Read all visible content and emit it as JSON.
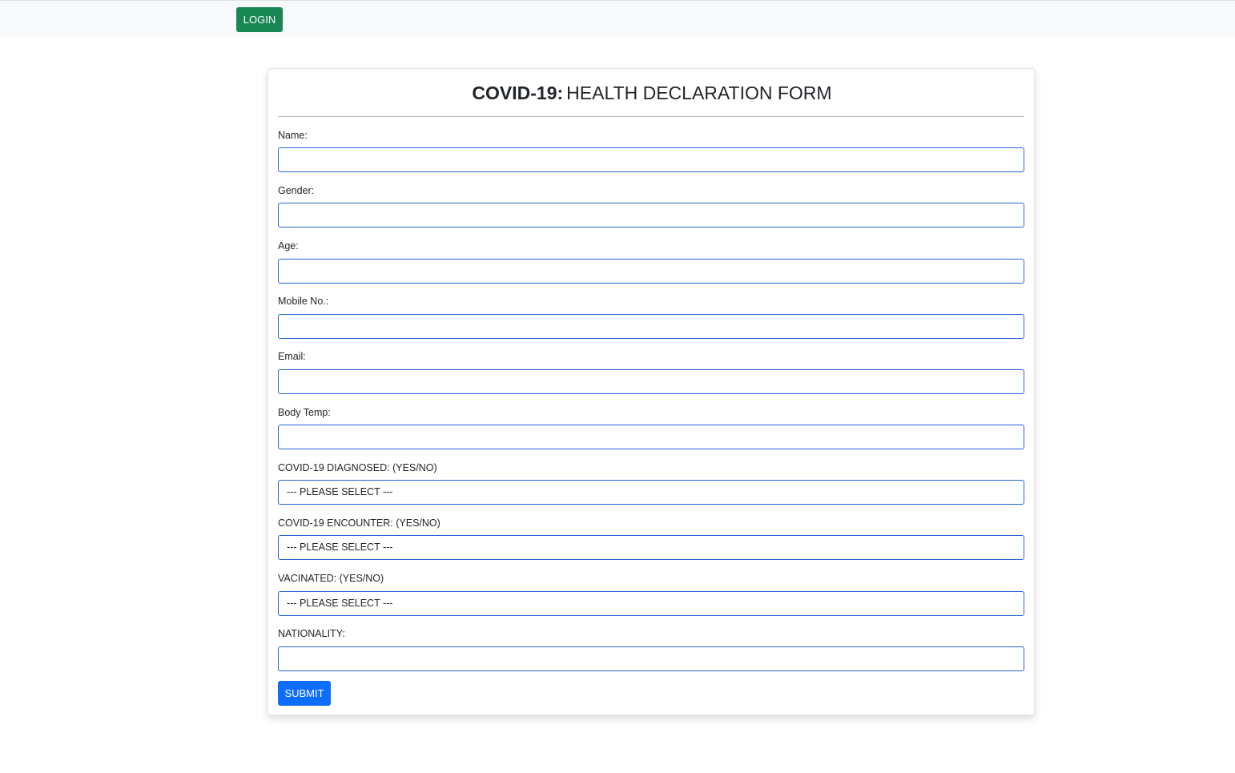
{
  "nav": {
    "login_label": "LOGIN"
  },
  "form": {
    "title_bold": "COVID-19:",
    "title_rest": "HEALTH DECLARATION FORM",
    "name_label": "Name:",
    "name_value": "",
    "gender_label": "Gender:",
    "gender_value": "",
    "age_label": "Age:",
    "age_value": "",
    "mobile_label": "Mobile No.:",
    "mobile_value": "",
    "email_label": "Email:",
    "email_value": "",
    "temp_label": "Body Temp:",
    "temp_value": "",
    "diagnosed_label": "COVID-19 DIAGNOSED: (YES/NO)",
    "diagnosed_selected": "--- PLEASE SELECT ---",
    "encounter_label": "COVID-19 ENCOUNTER: (YES/NO)",
    "encounter_selected": "--- PLEASE SELECT ---",
    "vaccinated_label": "VACINATED: (YES/NO)",
    "vaccinated_selected": "--- PLEASE SELECT ---",
    "nationality_label": "NATIONALITY:",
    "nationality_value": "",
    "submit_label": "SUBMIT"
  },
  "colors": {
    "login_button": "#198754",
    "submit_button": "#0d6efd",
    "input_border": "#2563d7",
    "topbar_background": "#f8f9fa"
  }
}
